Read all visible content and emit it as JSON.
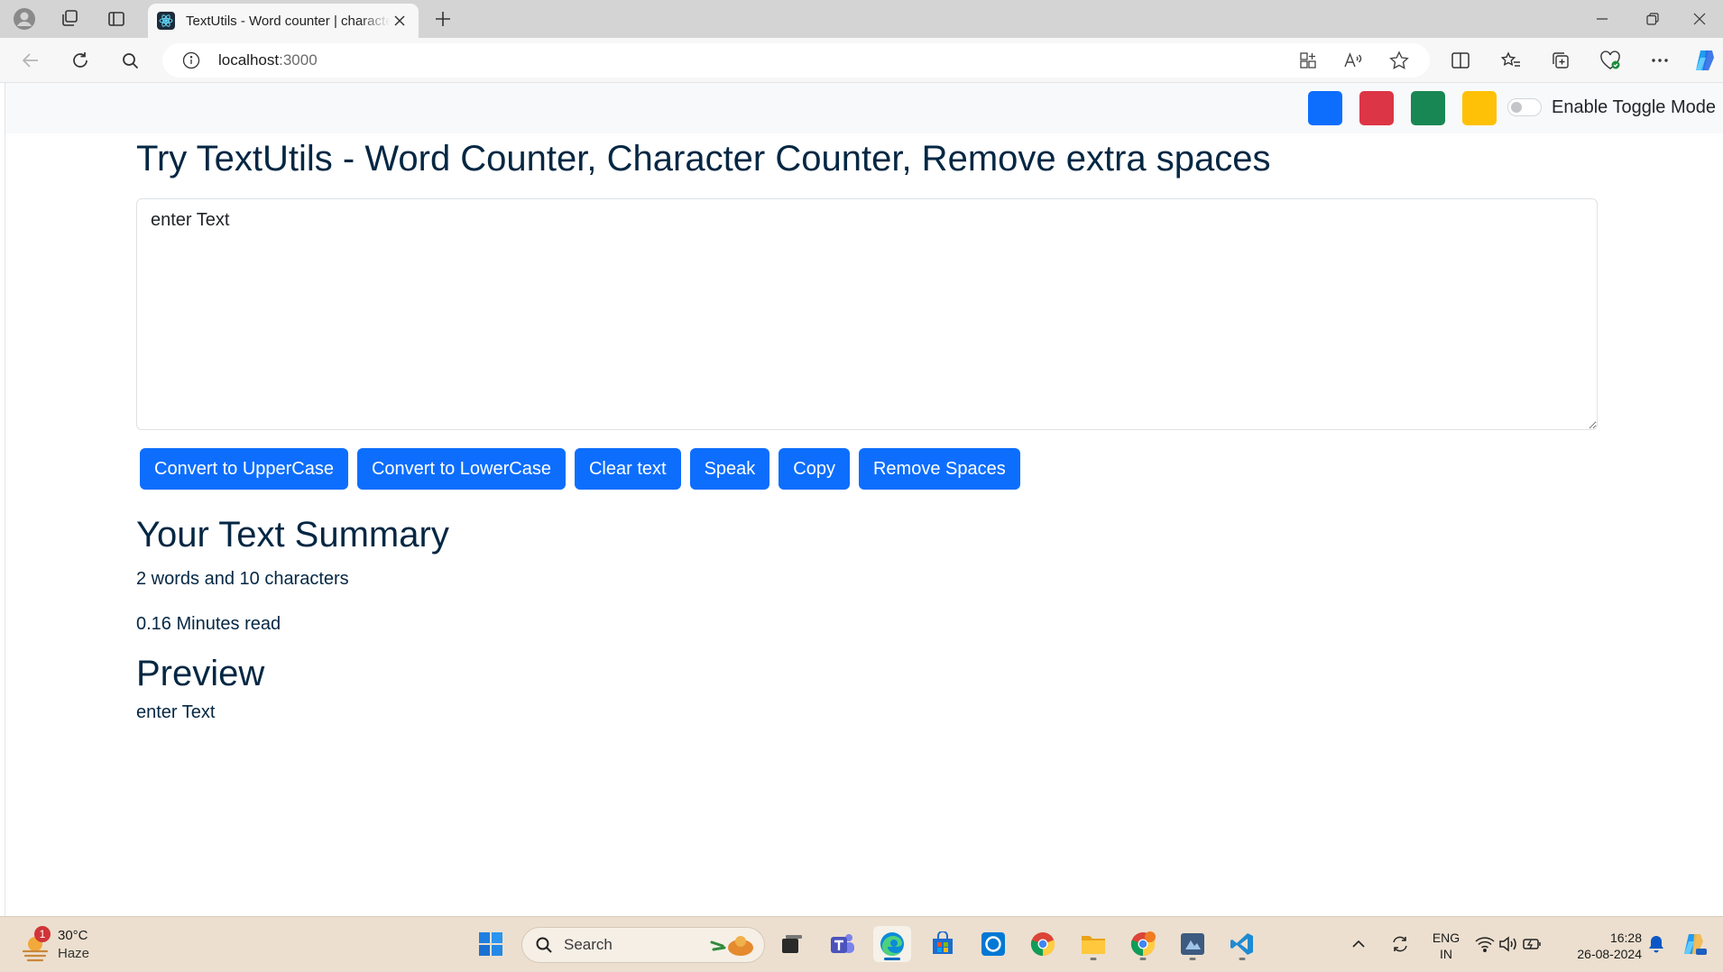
{
  "browser": {
    "tab": {
      "title": "TextUtils - Word counter | character counter"
    },
    "address": {
      "host": "localhost",
      "port": ":3000"
    }
  },
  "navbar": {
    "colors": [
      "#0d6efd",
      "#dc3545",
      "#198754",
      "#ffc107"
    ],
    "toggle_label": "Enable Toggle Mode"
  },
  "main": {
    "heading": "Try TextUtils - Word Counter, Character Counter, Remove extra spaces",
    "textarea_value": "enter Text",
    "buttons": [
      "Convert to UpperCase",
      "Convert to LowerCase",
      "Clear text",
      "Speak",
      "Copy",
      "Remove Spaces"
    ],
    "summary": {
      "title": "Your Text Summary",
      "counts": "2 words and 10 characters",
      "read_time": "0.16 Minutes read"
    },
    "preview": {
      "title": "Preview",
      "text": "enter Text"
    }
  },
  "taskbar": {
    "weather": {
      "temp": "30°C",
      "condition": "Haze",
      "badge": "1"
    },
    "search_label": "Search",
    "tray": {
      "lang_line1": "ENG",
      "lang_line2": "IN",
      "time": "16:28",
      "date": "26-08-2024"
    }
  }
}
